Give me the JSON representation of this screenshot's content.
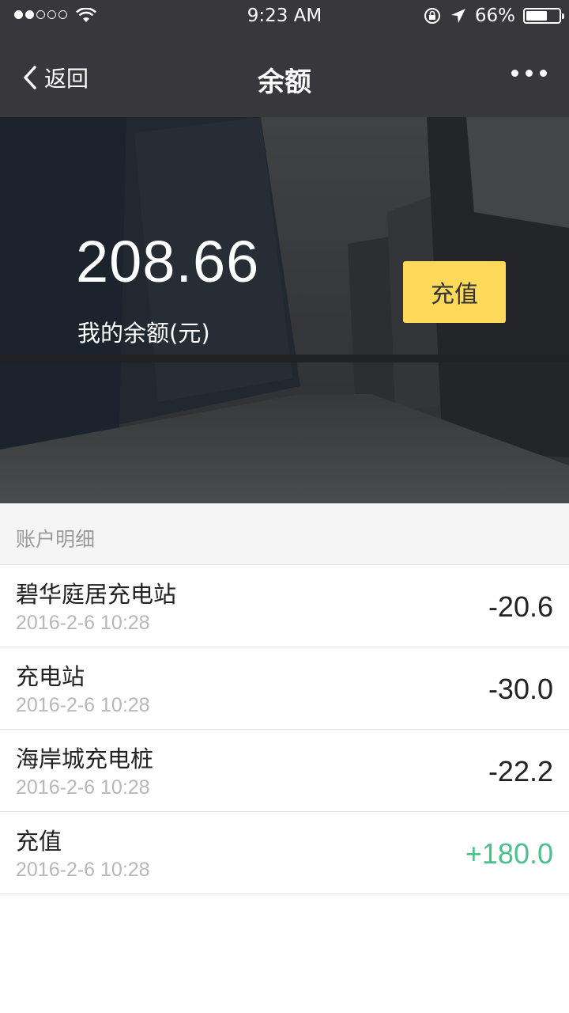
{
  "status": {
    "time": "9:23 AM",
    "battery_text": "66%",
    "battery_level": 0.66,
    "signal_bars_filled": 2,
    "signal_bars_total": 5
  },
  "nav": {
    "back_label": "返回",
    "title": "余额"
  },
  "balance": {
    "amount": "208.66",
    "label": "我的余额(元)",
    "recharge_label": "充值"
  },
  "details": {
    "title": "账户明细",
    "transactions": [
      {
        "name": "碧华庭居充电站",
        "time": "2016-2-6  10:28",
        "amount": "-20.6",
        "type": "debit"
      },
      {
        "name": "充电站",
        "time": "2016-2-6  10:28",
        "amount": "-30.0",
        "type": "debit"
      },
      {
        "name": "海岸城充电桩",
        "time": "2016-2-6  10:28",
        "amount": "-22.2",
        "type": "debit"
      },
      {
        "name": "充值",
        "time": "2016-2-6  10:28",
        "amount": "+180.0",
        "type": "credit"
      }
    ]
  },
  "colors": {
    "nav_bg": "#38383c",
    "recharge_button": "#ffd95a",
    "credit_amount": "#4cc08a"
  }
}
